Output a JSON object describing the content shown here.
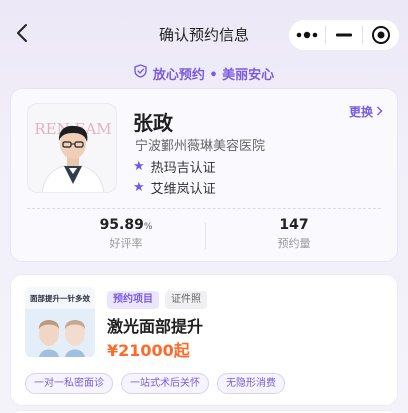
{
  "navbar": {
    "title": "确认预约信息",
    "back_icon": "back-chevron-icon",
    "menu_icon": "more-dots-icon",
    "minimize_icon": "minimize-icon",
    "close_icon": "target-close-icon"
  },
  "trust_banner": {
    "icon": "shield-check-icon",
    "text": "放心预约 • 美丽安心"
  },
  "doctor": {
    "name": "张政",
    "hospital": "宁波鄞州薇琳美容医院",
    "change_label": "更换",
    "avatar_watermark": "REN EAM",
    "certifications": [
      {
        "label": "热玛吉认证"
      },
      {
        "label": "艾维岚认证"
      }
    ],
    "stats": [
      {
        "value": "95.89",
        "unit": "%",
        "label": "好评率"
      },
      {
        "value": "147",
        "unit": "",
        "label": "预约量"
      }
    ]
  },
  "project": {
    "tags": [
      "预约项目",
      "证件照"
    ],
    "name": "激光面部提升",
    "price": "¥21000起",
    "thumbnail_caption": "面部提升一针多效",
    "features": [
      "一对一私密面诊",
      "一站式术后关怀",
      "无隐形消费"
    ]
  },
  "colors": {
    "accent": "#7b5ce0",
    "price": "#ff6a2b",
    "star": "#6b5be6"
  }
}
